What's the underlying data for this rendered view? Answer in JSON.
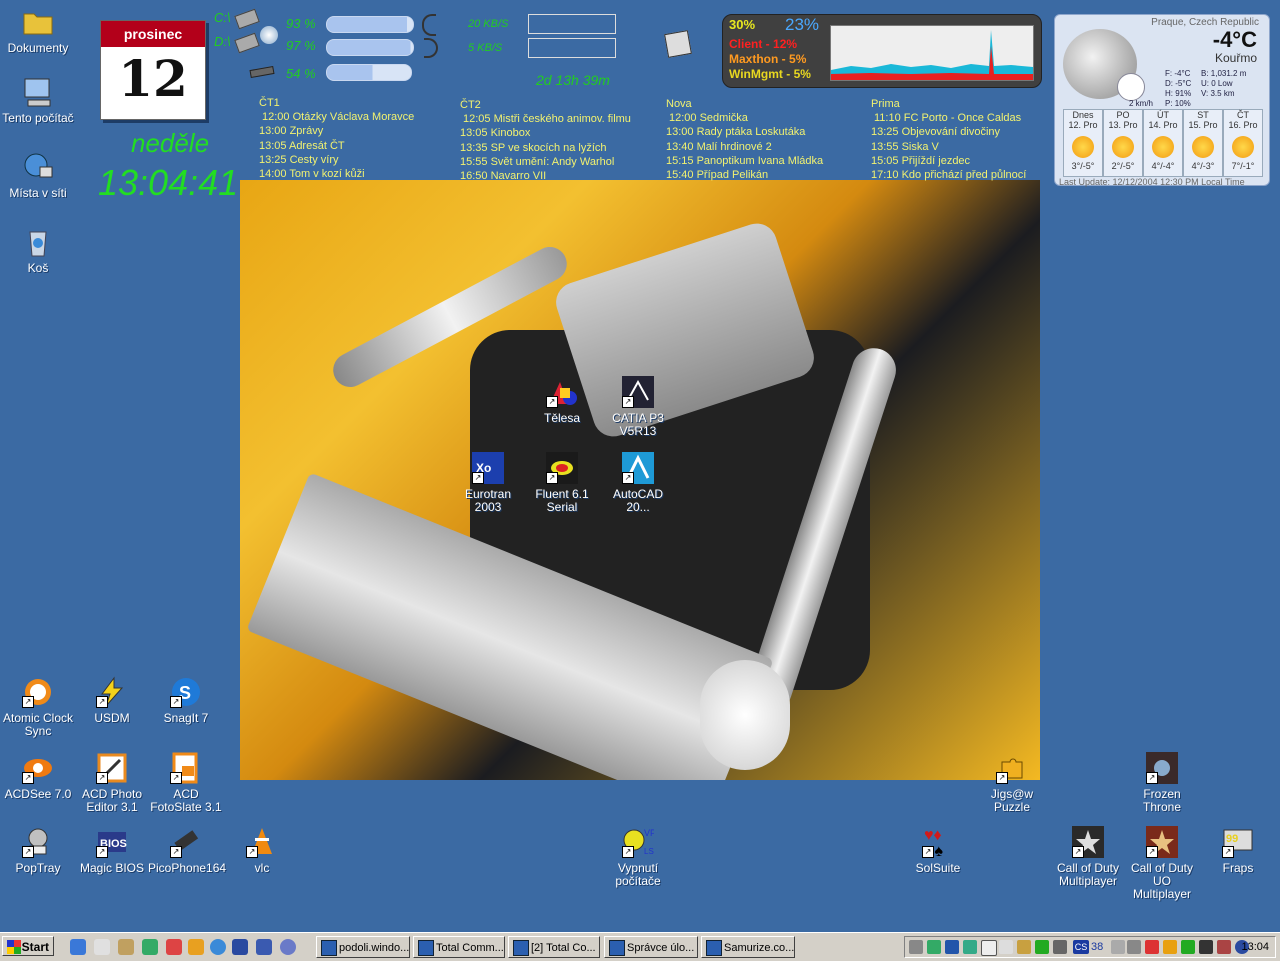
{
  "desktop_icons_left": [
    {
      "label": "Dokumenty",
      "icon": "folder-icon",
      "color": "#e8c23a"
    },
    {
      "label": "Tento počítač",
      "icon": "computer-icon",
      "color": "#9fc4ef"
    },
    {
      "label": "Místa v síti",
      "icon": "network-icon",
      "color": "#4a8fd8"
    },
    {
      "label": "Koš",
      "icon": "recycle-bin-icon",
      "color": "#c9d6e6"
    }
  ],
  "calendar": {
    "month": "prosinec",
    "day": "12",
    "weekday": "neděle",
    "time": "13:04:41"
  },
  "drives": [
    {
      "letter": "C:\\",
      "percent": "93 %",
      "fill": 0.93
    },
    {
      "letter": "D:\\",
      "percent": "97 %",
      "fill": 0.97
    },
    {
      "letter": "",
      "percent": "54 %",
      "fill": 0.54
    }
  ],
  "network": {
    "down": "20 KB/S",
    "up": "5 KB/S",
    "uptime": "2d 13h 39m"
  },
  "cpu": {
    "total": "30%",
    "second": "23%",
    "rows": [
      {
        "name": "Client",
        "value": "12%",
        "color": "#ff2020"
      },
      {
        "name": "Maxthon",
        "value": "5%",
        "color": "#ff9a20"
      },
      {
        "name": "WinMgmt",
        "value": "5%",
        "color": "#e8d820"
      }
    ]
  },
  "tv": [
    {
      "channel": "ČT1",
      "shows": [
        "12:00 Otázky Václava Moravce",
        "13:00 Zprávy",
        "13:05 Adresát ČT",
        "13:25 Cesty víry",
        "14:00 Tom v kozí kůži"
      ]
    },
    {
      "channel": "ČT2",
      "shows": [
        "12:05 Mistři českého animov. filmu",
        "13:05 Kinobox",
        "13:35 SP ve skocích na lyžích",
        "15:55 Svět umění: Andy Warhol",
        "16:50 Navarro VII"
      ]
    },
    {
      "channel": "Nova",
      "shows": [
        "12:00 Sedmička",
        "13:00 Rady ptáka Loskutáka",
        "13:40 Malí hrdinové 2",
        "15:15 Panoptikum Ivana Mládka",
        "15:40 Případ Pelikán"
      ]
    },
    {
      "channel": "Prima",
      "shows": [
        "11:10 FC Porto - Once Caldas",
        "13:25 Objevování divočiny",
        "13:55 Siska V",
        "15:05 Přijíždí jezdec",
        "17:10 Kdo přichází před půlnocí"
      ]
    }
  ],
  "weather": {
    "city": "Praque, Czech Republic",
    "temp": "-4°C",
    "cond": "Kouřmo",
    "details_left": [
      "F: -4°C",
      "D: -5°C",
      "H: 91%",
      "P: 10%"
    ],
    "details_right": [
      "B: 1,031.2 m",
      "U: 0 Low",
      "V: 3.5 km"
    ],
    "wind": "2 km/h",
    "forecast": [
      {
        "day": "Dnes",
        "date": "12. Pro",
        "range": "3°/-5°"
      },
      {
        "day": "PO",
        "date": "13. Pro",
        "range": "2°/-5°"
      },
      {
        "day": "ÚT",
        "date": "14. Pro",
        "range": "4°/-4°"
      },
      {
        "day": "ST",
        "date": "15. Pro",
        "range": "4°/-3°"
      },
      {
        "day": "ČT",
        "date": "16. Pro",
        "range": "7°/-1°"
      }
    ],
    "updated": "Last Update: 12/12/2004 12:30 PM Local Time"
  },
  "center_icons": [
    {
      "label": "Tělesa",
      "icon": "telesa-icon",
      "color": "#d23"
    },
    {
      "label": "CATIA P3 V5R13",
      "icon": "catia-icon",
      "color": "#223"
    },
    {
      "label": "Eurotran 2003",
      "icon": "eurotran-icon",
      "color": "#1c3fae"
    },
    {
      "label": "Fluent 6.1 Serial",
      "icon": "fluent-icon",
      "color": "#1a1a1a"
    },
    {
      "label": "AutoCAD 20...",
      "icon": "autocad-icon",
      "color": "#1e9ad6"
    }
  ],
  "bottom_icons": [
    {
      "label": "Atomic Clock Sync",
      "icon": "atomic-clock-icon",
      "color": "#f08a18"
    },
    {
      "label": "USDM",
      "icon": "usdm-icon",
      "color": "#f4d21a"
    },
    {
      "label": "SnagIt 7",
      "icon": "snagit-icon",
      "color": "#1f7ad8"
    },
    {
      "label": "ACDSee 7.0",
      "icon": "acdsee-icon",
      "color": "#f07a10"
    },
    {
      "label": "ACD Photo Editor 3.1",
      "icon": "acd-photo-editor-icon",
      "color": "#e88a20"
    },
    {
      "label": "ACD FotoSlate 3.1",
      "icon": "acd-fotoslate-icon",
      "color": "#f08a18"
    },
    {
      "label": "PopTray",
      "icon": "poptray-icon",
      "color": "#c0c0c0"
    },
    {
      "label": "Magic BIOS",
      "icon": "magic-bios-icon",
      "color": "#2a3a8a"
    },
    {
      "label": "PicoPhone164",
      "icon": "picophone-icon",
      "color": "#333"
    },
    {
      "label": "vlc",
      "icon": "vlc-icon",
      "color": "#f08a10"
    },
    {
      "label": "Vypnutí počítače",
      "icon": "shutdown-icon",
      "color": "#e8e020"
    },
    {
      "label": "SolSuite",
      "icon": "solsuite-icon",
      "color": "#d21a1a"
    },
    {
      "label": "Call of Duty Multiplayer",
      "icon": "cod-mp-icon",
      "color": "#2a2a2a"
    },
    {
      "label": "Call of Duty UO Multiplayer",
      "icon": "cod-uo-icon",
      "color": "#7a2a1a"
    },
    {
      "label": "Fraps",
      "icon": "fraps-icon",
      "color": "#e8d020"
    },
    {
      "label": "Jigs@w Puzzle",
      "icon": "jigsaw-icon",
      "color": "#f0b020"
    },
    {
      "label": "Frozen Throne",
      "icon": "frozen-throne-icon",
      "color": "#3a2a2a"
    }
  ],
  "taskbar": {
    "start_label": "Start",
    "quicklaunch": [
      "#3a78d8",
      "#e0e0e0",
      "#c0a060",
      "#3a6",
      "#d44",
      "#e8a020",
      "#3a8ad8",
      "#2a4aa0",
      "#3a5ab0",
      "#6a7ac8"
    ],
    "tasks": [
      "podoli.windo...",
      "Total Comm...",
      "[2] Total Co...",
      "Správce úlo...",
      "Samurize.co..."
    ],
    "tray_text": "38",
    "clock": "13:04"
  }
}
